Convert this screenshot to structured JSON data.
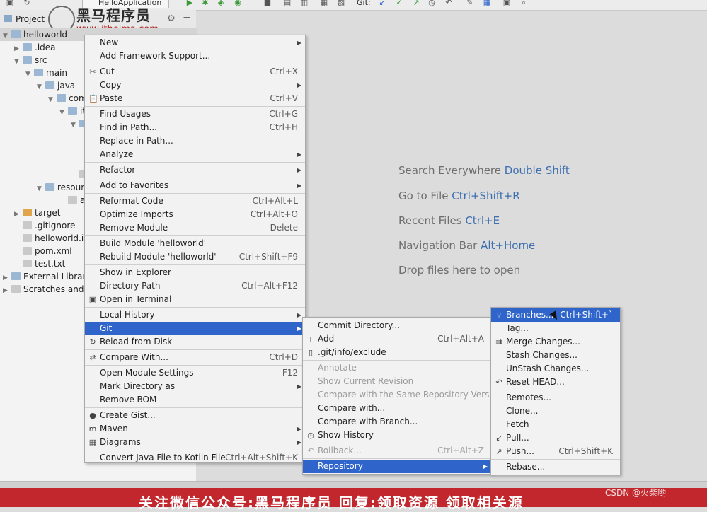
{
  "toolbar": {
    "run_config": "HelloApplication",
    "git_label": "Git:"
  },
  "watermark": {
    "brand": "黑马程序员",
    "url": "www.itheima.com"
  },
  "project_panel": {
    "title": "Project",
    "tree": [
      {
        "label": "helloworld",
        "indent": 0,
        "arrow": "▼",
        "icon": "folder",
        "selected": true
      },
      {
        "label": ".idea",
        "indent": 1,
        "arrow": "▶",
        "icon": "folder"
      },
      {
        "label": "src",
        "indent": 1,
        "arrow": "▼",
        "icon": "folder"
      },
      {
        "label": "main",
        "indent": 2,
        "arrow": "▼",
        "icon": "folder"
      },
      {
        "label": "java",
        "indent": 3,
        "arrow": "▼",
        "icon": "folder"
      },
      {
        "label": "com",
        "indent": 4,
        "arrow": "▼",
        "icon": "folder"
      },
      {
        "label": "it",
        "indent": 5,
        "arrow": "▼",
        "icon": "folder"
      },
      {
        "label": "",
        "indent": 6,
        "arrow": "▼",
        "icon": "folder"
      },
      {
        "label": "",
        "indent": 0,
        "arrow": "",
        "icon": "none"
      },
      {
        "label": "",
        "indent": 0,
        "arrow": "",
        "icon": "none"
      },
      {
        "label": "",
        "indent": 0,
        "arrow": "",
        "icon": "none"
      },
      {
        "label": "",
        "indent": 6,
        "arrow": "",
        "icon": "file"
      },
      {
        "label": "resourc",
        "indent": 3,
        "arrow": "▼",
        "icon": "folder"
      },
      {
        "label": "appl",
        "indent": 5,
        "arrow": "",
        "icon": "file"
      },
      {
        "label": "target",
        "indent": 1,
        "arrow": "▶",
        "icon": "folder-o"
      },
      {
        "label": ".gitignore",
        "indent": 1,
        "arrow": "",
        "icon": "file"
      },
      {
        "label": "helloworld.im",
        "indent": 1,
        "arrow": "",
        "icon": "file"
      },
      {
        "label": "pom.xml",
        "indent": 1,
        "arrow": "",
        "icon": "file"
      },
      {
        "label": "test.txt",
        "indent": 1,
        "arrow": "",
        "icon": "file"
      },
      {
        "label": "External Libraries",
        "indent": 0,
        "arrow": "▶",
        "icon": "folder"
      },
      {
        "label": "Scratches and Co",
        "indent": 0,
        "arrow": "▶",
        "icon": "file"
      }
    ]
  },
  "editor_hints": [
    {
      "text": "Search Everywhere",
      "key": "Double Shift"
    },
    {
      "text": "Go to File",
      "key": "Ctrl+Shift+R"
    },
    {
      "text": "Recent Files",
      "key": "Ctrl+E"
    },
    {
      "text": "Navigation Bar",
      "key": "Alt+Home"
    },
    {
      "text": "Drop files here to open",
      "key": ""
    }
  ],
  "context_menu": [
    {
      "label": "New",
      "submenu": true
    },
    {
      "label": "Add Framework Support..."
    },
    {
      "sep": true
    },
    {
      "label": "Cut",
      "shortcut": "Ctrl+X",
      "icon": "✂"
    },
    {
      "label": "Copy",
      "submenu": true
    },
    {
      "label": "Paste",
      "shortcut": "Ctrl+V",
      "icon": "📋"
    },
    {
      "sep": true
    },
    {
      "label": "Find Usages",
      "shortcut": "Ctrl+G"
    },
    {
      "label": "Find in Path...",
      "shortcut": "Ctrl+H"
    },
    {
      "label": "Replace in Path..."
    },
    {
      "label": "Analyze",
      "submenu": true
    },
    {
      "sep": true
    },
    {
      "label": "Refactor",
      "submenu": true
    },
    {
      "sep": true
    },
    {
      "label": "Add to Favorites",
      "submenu": true
    },
    {
      "sep": true
    },
    {
      "label": "Reformat Code",
      "shortcut": "Ctrl+Alt+L"
    },
    {
      "label": "Optimize Imports",
      "shortcut": "Ctrl+Alt+O"
    },
    {
      "label": "Remove Module",
      "shortcut": "Delete"
    },
    {
      "sep": true
    },
    {
      "label": "Build Module 'helloworld'"
    },
    {
      "label": "Rebuild Module 'helloworld'",
      "shortcut": "Ctrl+Shift+F9"
    },
    {
      "sep": true
    },
    {
      "label": "Show in Explorer"
    },
    {
      "label": "Directory Path",
      "shortcut": "Ctrl+Alt+F12"
    },
    {
      "label": "Open in Terminal",
      "icon": "▣"
    },
    {
      "sep": true
    },
    {
      "label": "Local History",
      "submenu": true
    },
    {
      "label": "Git",
      "submenu": true,
      "highlight": true
    },
    {
      "label": "Reload from Disk",
      "icon": "↻"
    },
    {
      "sep": true
    },
    {
      "label": "Compare With...",
      "shortcut": "Ctrl+D",
      "icon": "⇄"
    },
    {
      "sep": true
    },
    {
      "label": "Open Module Settings",
      "shortcut": "F12"
    },
    {
      "label": "Mark Directory as",
      "submenu": true
    },
    {
      "label": "Remove BOM"
    },
    {
      "sep": true
    },
    {
      "label": "Create Gist...",
      "icon": "●"
    },
    {
      "label": "Maven",
      "submenu": true,
      "icon": "m"
    },
    {
      "label": "Diagrams",
      "submenu": true,
      "icon": "▦"
    },
    {
      "sep": true
    },
    {
      "label": "Convert Java File to Kotlin File",
      "shortcut": "Ctrl+Alt+Shift+K"
    }
  ],
  "git_menu": [
    {
      "label": "Commit Directory..."
    },
    {
      "label": "Add",
      "shortcut": "Ctrl+Alt+A",
      "icon": "+"
    },
    {
      "label": ".git/info/exclude",
      "icon": "▯"
    },
    {
      "sep": true
    },
    {
      "label": "Annotate",
      "disabled": true
    },
    {
      "label": "Show Current Revision",
      "disabled": true
    },
    {
      "label": "Compare with the Same Repository Version",
      "disabled": true
    },
    {
      "label": "Compare with..."
    },
    {
      "label": "Compare with Branch..."
    },
    {
      "label": "Show History",
      "icon": "◷"
    },
    {
      "sep": true
    },
    {
      "label": "Rollback...",
      "shortcut": "Ctrl+Alt+Z",
      "disabled": true,
      "icon": "↶"
    },
    {
      "sep": true
    },
    {
      "label": "Repository",
      "submenu": true,
      "highlight": true
    }
  ],
  "repo_menu": [
    {
      "label": "Branches...",
      "shortcut": "Ctrl+Shift+`",
      "highlight": true,
      "icon": "⑂"
    },
    {
      "label": "Tag..."
    },
    {
      "label": "Merge Changes...",
      "icon": "⇉"
    },
    {
      "label": "Stash Changes..."
    },
    {
      "label": "UnStash Changes..."
    },
    {
      "label": "Reset HEAD...",
      "icon": "↶"
    },
    {
      "sep": true
    },
    {
      "label": "Remotes..."
    },
    {
      "label": "Clone..."
    },
    {
      "label": "Fetch"
    },
    {
      "label": "Pull...",
      "icon": "↙"
    },
    {
      "label": "Push...",
      "shortcut": "Ctrl+Shift+K",
      "icon": "↗"
    },
    {
      "sep": true
    },
    {
      "label": "Rebase..."
    }
  ],
  "banner": {
    "text": "关注微信公众号:黑马程序员 回复:领取资源 领取相关源",
    "credit": "CSDN @火柴哟"
  }
}
